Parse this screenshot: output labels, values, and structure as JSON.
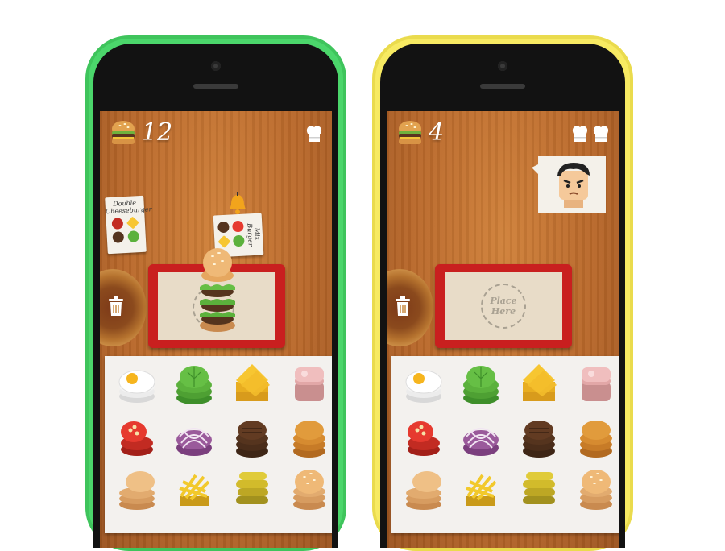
{
  "left_phone": {
    "score": "12",
    "chef_hats": 1,
    "order_cards": [
      {
        "title": "Double Cheeseburger"
      },
      {
        "title": "Mix Burger"
      }
    ],
    "burger_stack": true
  },
  "right_phone": {
    "score": "4",
    "chef_hats": 2,
    "customer": "angry-man",
    "place_here_label": "Place Here"
  },
  "ingredients": [
    "egg",
    "lettuce",
    "cheese",
    "ham",
    "tomato",
    "onion",
    "beef-patty",
    "chicken-patty",
    "bottom-bun",
    "fries",
    "pickles",
    "top-bun"
  ],
  "colors": {
    "left_phone": "#4bd66b",
    "right_phone": "#f7ea62",
    "tray": "#c91f1f",
    "table": "#b9682a"
  }
}
